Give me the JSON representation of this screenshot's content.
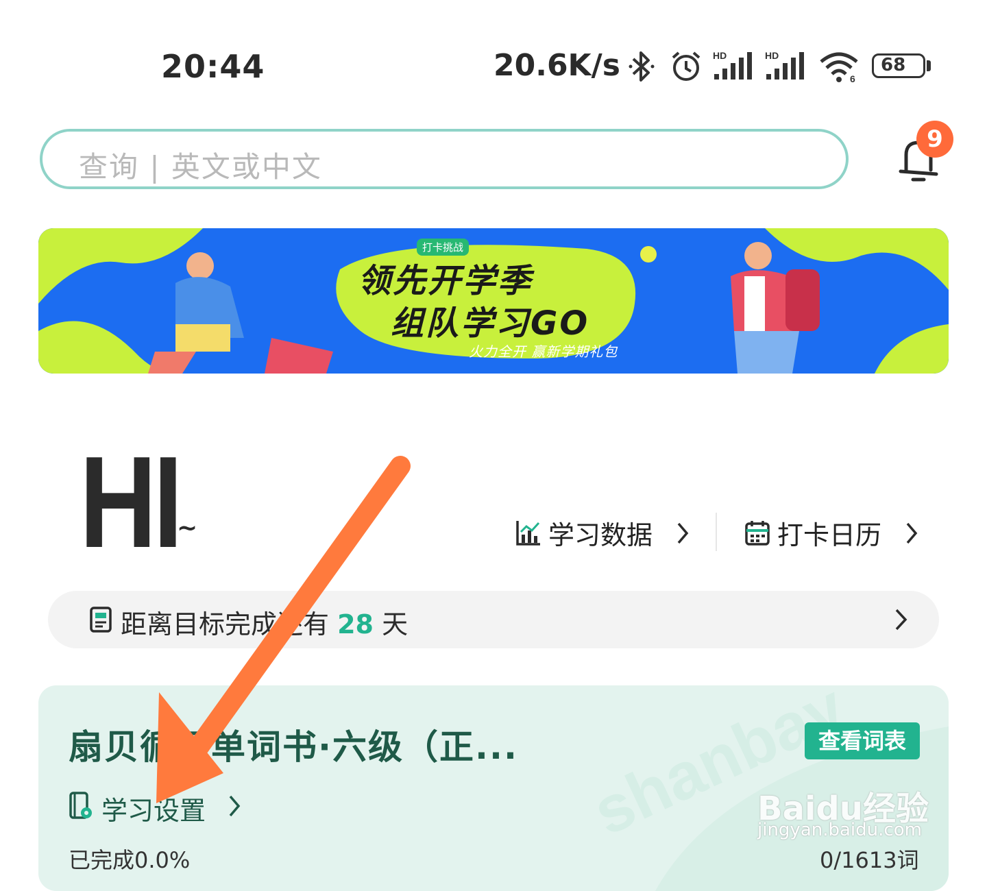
{
  "status_bar": {
    "time": "20:44",
    "net_speed": "20.6K/s",
    "battery": "68",
    "icons": [
      "bluetooth-icon",
      "alarm-icon",
      "signal-hd-icon",
      "signal-hd-icon",
      "wifi-icon",
      "battery-icon"
    ]
  },
  "search": {
    "placeholder": "查询 | 英文或中文"
  },
  "notifications": {
    "count": "9"
  },
  "banner": {
    "tag": "打卡挑战",
    "line1": "领先开学季",
    "line2": "组队学习GO",
    "subtitle": "火力全开 赢新学期礼包"
  },
  "greeting": {
    "hi": "HI",
    "tilde": "~"
  },
  "links": {
    "study_data": "学习数据",
    "checkin_calendar": "打卡日历"
  },
  "goal": {
    "prefix": "距离目标完成还有",
    "days": "28",
    "suffix": "天"
  },
  "book": {
    "title": "扇贝循环单词书·六级（正...",
    "wordlist_button": "查看词表",
    "settings": "学习设置",
    "progress": "已完成0.0%",
    "count": "0/1613词"
  },
  "watermark": {
    "brand": "Baidu经验",
    "url": "jingyan.baidu.com"
  },
  "colors": {
    "accent": "#22b38f",
    "arrow": "#ff7a3d",
    "badge": "#ff6a3a",
    "banner_blue": "#1c6df1"
  }
}
